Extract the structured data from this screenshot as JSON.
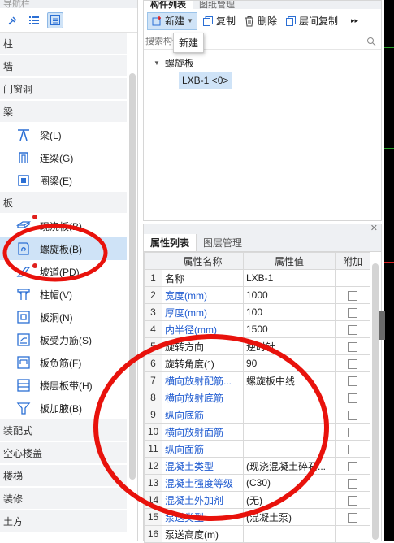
{
  "nav": {
    "header": "导航栏",
    "categories": {
      "zhu": "柱",
      "qiang": "墙",
      "menchuang": "门窗洞",
      "liang": "梁",
      "ban": "板",
      "zhuangpei": "装配式",
      "kongxin": "空心楼盖",
      "louti": "楼梯",
      "zhuangxiu": "装修",
      "tufang": "土方"
    },
    "liang_items": [
      "梁(L)",
      "连梁(G)",
      "圈梁(E)"
    ],
    "ban_items": [
      "现浇板(B)",
      "螺旋板(B)",
      "坡道(PD)",
      "柱帽(V)",
      "板洞(N)",
      "板受力筋(S)",
      "板负筋(F)",
      "楼层板带(H)",
      "板加腋(B)"
    ]
  },
  "component_panel": {
    "tabs": [
      "构件列表",
      "图纸管理"
    ],
    "toolbar": {
      "new": "新建",
      "copy": "复制",
      "delete": "删除",
      "floor_copy": "层间复制"
    },
    "search_placeholder": "搜索构件...",
    "tooltip": "新建",
    "tree_root": "螺旋板",
    "tree_child": "LXB-1 <0>"
  },
  "property_panel": {
    "tabs": [
      "属性列表",
      "图层管理"
    ],
    "columns": [
      "属性名称",
      "属性值",
      "附加"
    ],
    "rows": [
      {
        "num": "1",
        "name": "名称",
        "value": "LXB-1"
      },
      {
        "num": "2",
        "name": "宽度(mm)",
        "value": "1000"
      },
      {
        "num": "3",
        "name": "厚度(mm)",
        "value": "100"
      },
      {
        "num": "4",
        "name": "内半径(mm)",
        "value": "1500"
      },
      {
        "num": "5",
        "name": "旋转方向",
        "value": "逆时针"
      },
      {
        "num": "6",
        "name": "旋转角度(°)",
        "value": "90"
      },
      {
        "num": "7",
        "name": "横向放射配筋...",
        "value": "螺旋板中线"
      },
      {
        "num": "8",
        "name": "横向放射底筋",
        "value": ""
      },
      {
        "num": "9",
        "name": "纵向底筋",
        "value": ""
      },
      {
        "num": "10",
        "name": "横向放射面筋",
        "value": ""
      },
      {
        "num": "11",
        "name": "纵向面筋",
        "value": ""
      },
      {
        "num": "12",
        "name": "混凝土类型",
        "value": "(现浇混凝土碎石..."
      },
      {
        "num": "13",
        "name": "混凝土强度等级",
        "value": "(C30)"
      },
      {
        "num": "14",
        "name": "混凝土外加剂",
        "value": "(无)"
      },
      {
        "num": "15",
        "name": "泵送类型",
        "value": "(混凝土泵)"
      },
      {
        "num": "16",
        "name": "泵送高度(m)",
        "value": ""
      }
    ]
  },
  "colors": {
    "accent_blue": "#1f5bd0",
    "selection": "#cfe3f7",
    "annotation_red": "#e8120c"
  }
}
